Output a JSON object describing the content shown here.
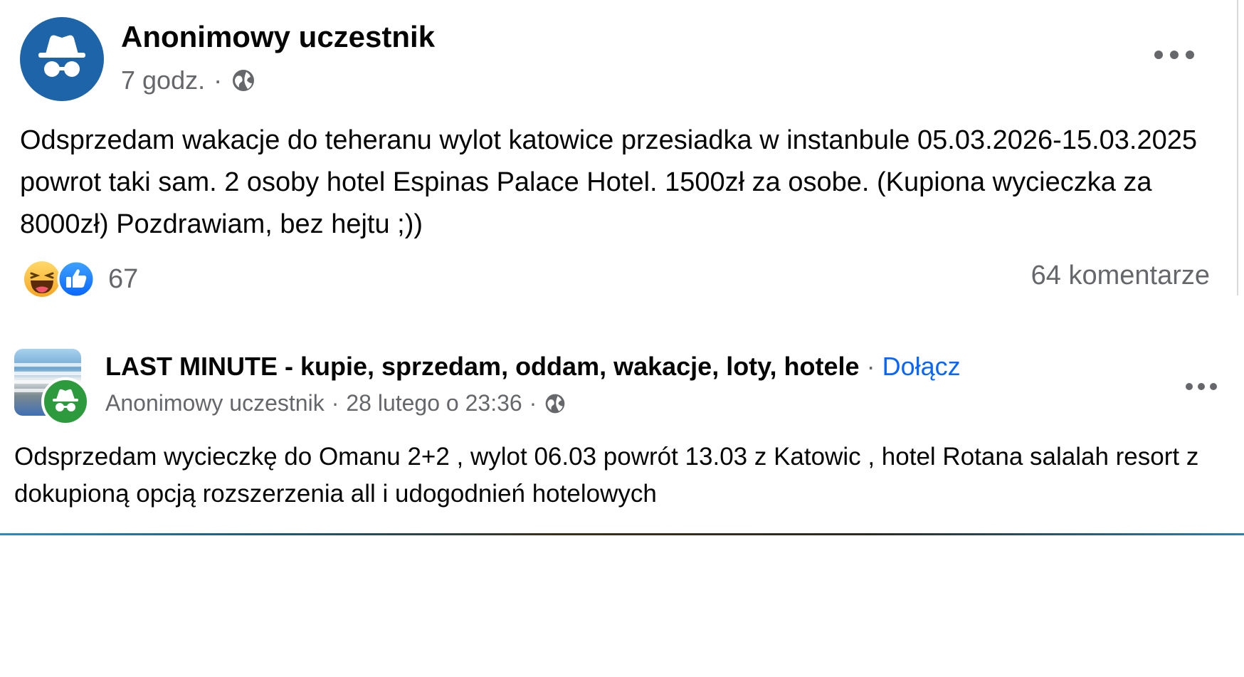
{
  "post1": {
    "author": "Anonimowy uczestnik",
    "time": "7 godz.",
    "separator": "·",
    "text": "Odsprzedam wakacje do teheranu wylot katowice przesiadka w instanbule 05.03.2026-15.03.2025 powrot taki sam. 2 osoby hotel Espinas Palace Hotel. 1500zł za osobe. (Kupiona wycieczka za 8000zł) Pozdrawiam, bez hejtu ;))",
    "reaction_count": "67",
    "comments": "64 komentarze",
    "reactions": [
      "haha-icon",
      "like-icon"
    ]
  },
  "post2": {
    "group": "LAST MINUTE - kupie, sprzedam, oddam, wakacje, loty, hotele",
    "separator": "·",
    "join_label": "Dołącz",
    "author": "Anonimowy uczestnik",
    "date": "28 lutego o 23:36",
    "text": "Odsprzedam wycieczkę do Omanu 2+2 , wylot 06.03 powrót 13.03 z Katowic , hotel Rotana salalah resort z dokupioną opcją rozszerzenia all i udogodnień hotelowych"
  },
  "colors": {
    "anon_avatar": "#1d64a8",
    "anon_avatar_group": "#2e9a3e",
    "secondary_text": "#65676b",
    "link_blue": "#0866ff"
  }
}
